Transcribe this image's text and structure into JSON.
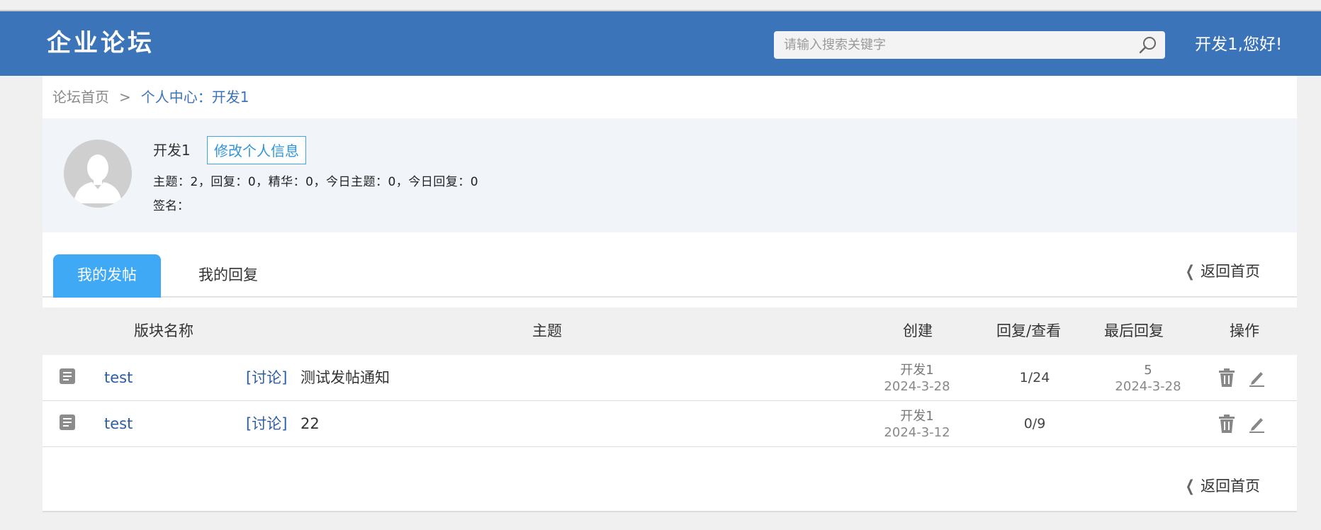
{
  "header": {
    "logo": "企业论坛",
    "search_placeholder": "请输入搜索关键字",
    "greeting": "开发1,您好!"
  },
  "breadcrumb": {
    "home": "论坛首页",
    "separator": ">",
    "current": "个人中心：开发1"
  },
  "profile": {
    "username": "开发1",
    "edit_label": "修改个人信息",
    "stats": "主题：2，回复：0，精华：0，今日主题：0，今日回复：0",
    "signature_label": "签名：",
    "signature_value": ""
  },
  "tabs": [
    {
      "label": "我的发帖",
      "active": true
    },
    {
      "label": "我的回复",
      "active": false
    }
  ],
  "back_home": "返回首页",
  "table": {
    "headers": {
      "board": "版块名称",
      "topic": "主题",
      "created": "创建",
      "reply_view": "回复/查看",
      "last_reply": "最后回复",
      "action": "操作"
    },
    "rows": [
      {
        "board": "test",
        "tag": "[讨论]",
        "title": "测试发帖通知",
        "author": "开发1",
        "date": "2024-3-28",
        "counts": "1/24",
        "last_reply_user": "5",
        "last_reply_date": "2024-3-28"
      },
      {
        "board": "test",
        "tag": "[讨论]",
        "title": "22",
        "author": "开发1",
        "date": "2024-3-12",
        "counts": "0/9",
        "last_reply_user": "",
        "last_reply_date": ""
      }
    ]
  },
  "icons": {
    "search": "search-icon",
    "avatar": "user-silhouette-icon",
    "row": "document-icon",
    "delete": "trash-icon",
    "edit": "pencil-icon",
    "back": "chevron-left-icon"
  },
  "colors": {
    "header_bg": "#3b74b8",
    "tab_active": "#3fa9f5",
    "link": "#2a5ea8",
    "profile_bg": "#f1f5fa"
  }
}
